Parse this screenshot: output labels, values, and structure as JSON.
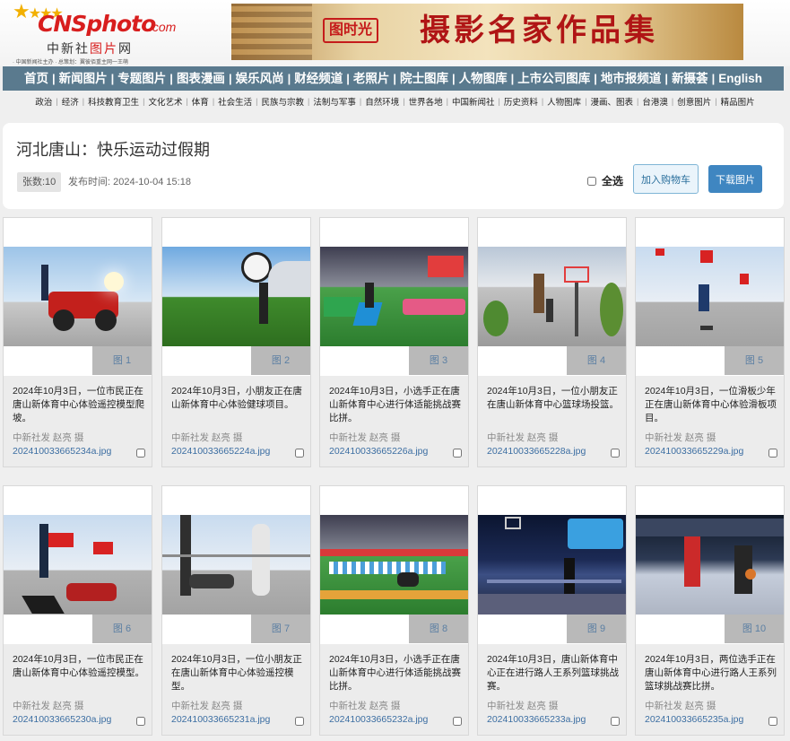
{
  "logo": {
    "brand": "CNSphoto",
    "domain_suffix": ".com",
    "cn_name_a": "中新社",
    "cn_name_b": "图片",
    "cn_name_c": "网",
    "slogan": "· 中国新闻社主办 · 总策划：翼彼佰重主网一王萌"
  },
  "banner": {
    "seal": "图时光",
    "title": "摄影名家作品集"
  },
  "main_nav": [
    "首页",
    "新闻图片",
    "专题图片",
    "图表漫画",
    "娱乐风尚",
    "财经频道",
    "老照片",
    "院士图库",
    "人物图库",
    "上市公司图库",
    "地市报频道",
    "新摄荟",
    "English"
  ],
  "sub_nav": [
    "政治",
    "经济",
    "科技教育卫生",
    "文化艺术",
    "体育",
    "社会生活",
    "民族与宗教",
    "法制与军事",
    "自然环境",
    "世界各地",
    "中国新闻社",
    "历史资料",
    "人物图库",
    "漫画、图表",
    "台港澳",
    "创意图片",
    "精品图片"
  ],
  "gallery": {
    "title": "河北唐山：快乐运动过假期",
    "count_label": "张数:10",
    "date_label": "发布时间: 2024-10-04 15:18",
    "select_all": "全选",
    "add_cart": "加入购物车",
    "download": "下载图片"
  },
  "photos": [
    {
      "num": "图 1",
      "caption": "2024年10月3日，一位市民正在唐山新体育中心体验遥控模型爬坡。",
      "credit": "中新社发 赵亮 摄",
      "file": "202410033665234a.jpg"
    },
    {
      "num": "图 2",
      "caption": "2024年10月3日，小朋友正在唐山新体育中心体验健球项目。",
      "credit": "中新社发 赵亮 摄",
      "file": "202410033665224a.jpg"
    },
    {
      "num": "图 3",
      "caption": "2024年10月3日，小选手正在唐山新体育中心进行体适能挑战赛比拼。",
      "credit": "中新社发 赵亮 摄",
      "file": "202410033665226a.jpg"
    },
    {
      "num": "图 4",
      "caption": "2024年10月3日，一位小朋友正在唐山新体育中心篮球场投篮。",
      "credit": "中新社发 赵亮 摄",
      "file": "202410033665228a.jpg"
    },
    {
      "num": "图 5",
      "caption": "2024年10月3日，一位滑板少年正在唐山新体育中心体验滑板项目。",
      "credit": "中新社发 赵亮 摄",
      "file": "202410033665229a.jpg"
    },
    {
      "num": "图 6",
      "caption": "2024年10月3日，一位市民正在唐山新体育中心体验遥控模型。",
      "credit": "中新社发 赵亮 摄",
      "file": "202410033665230a.jpg"
    },
    {
      "num": "图 7",
      "caption": "2024年10月3日，一位小朋友正在唐山新体育中心体验遥控模型。",
      "credit": "中新社发 赵亮 摄",
      "file": "202410033665231a.jpg"
    },
    {
      "num": "图 8",
      "caption": "2024年10月3日，小选手正在唐山新体育中心进行体适能挑战赛比拼。",
      "credit": "中新社发 赵亮 摄",
      "file": "202410033665232a.jpg"
    },
    {
      "num": "图 9",
      "caption": "2024年10月3日，唐山新体育中心正在进行路人王系列篮球挑战赛。",
      "credit": "中新社发 赵亮 摄",
      "file": "202410033665233a.jpg"
    },
    {
      "num": "图 10",
      "caption": "2024年10月3日，两位选手正在唐山新体育中心进行路人王系列篮球挑战赛比拼。",
      "credit": "中新社发 赵亮 摄",
      "file": "202410033665235a.jpg"
    }
  ],
  "colors": {
    "nav_bg": "#5a7a8e",
    "brand_red": "#d81e1e",
    "link_blue": "#3c6ea2",
    "download_btn": "#3f86c1"
  }
}
